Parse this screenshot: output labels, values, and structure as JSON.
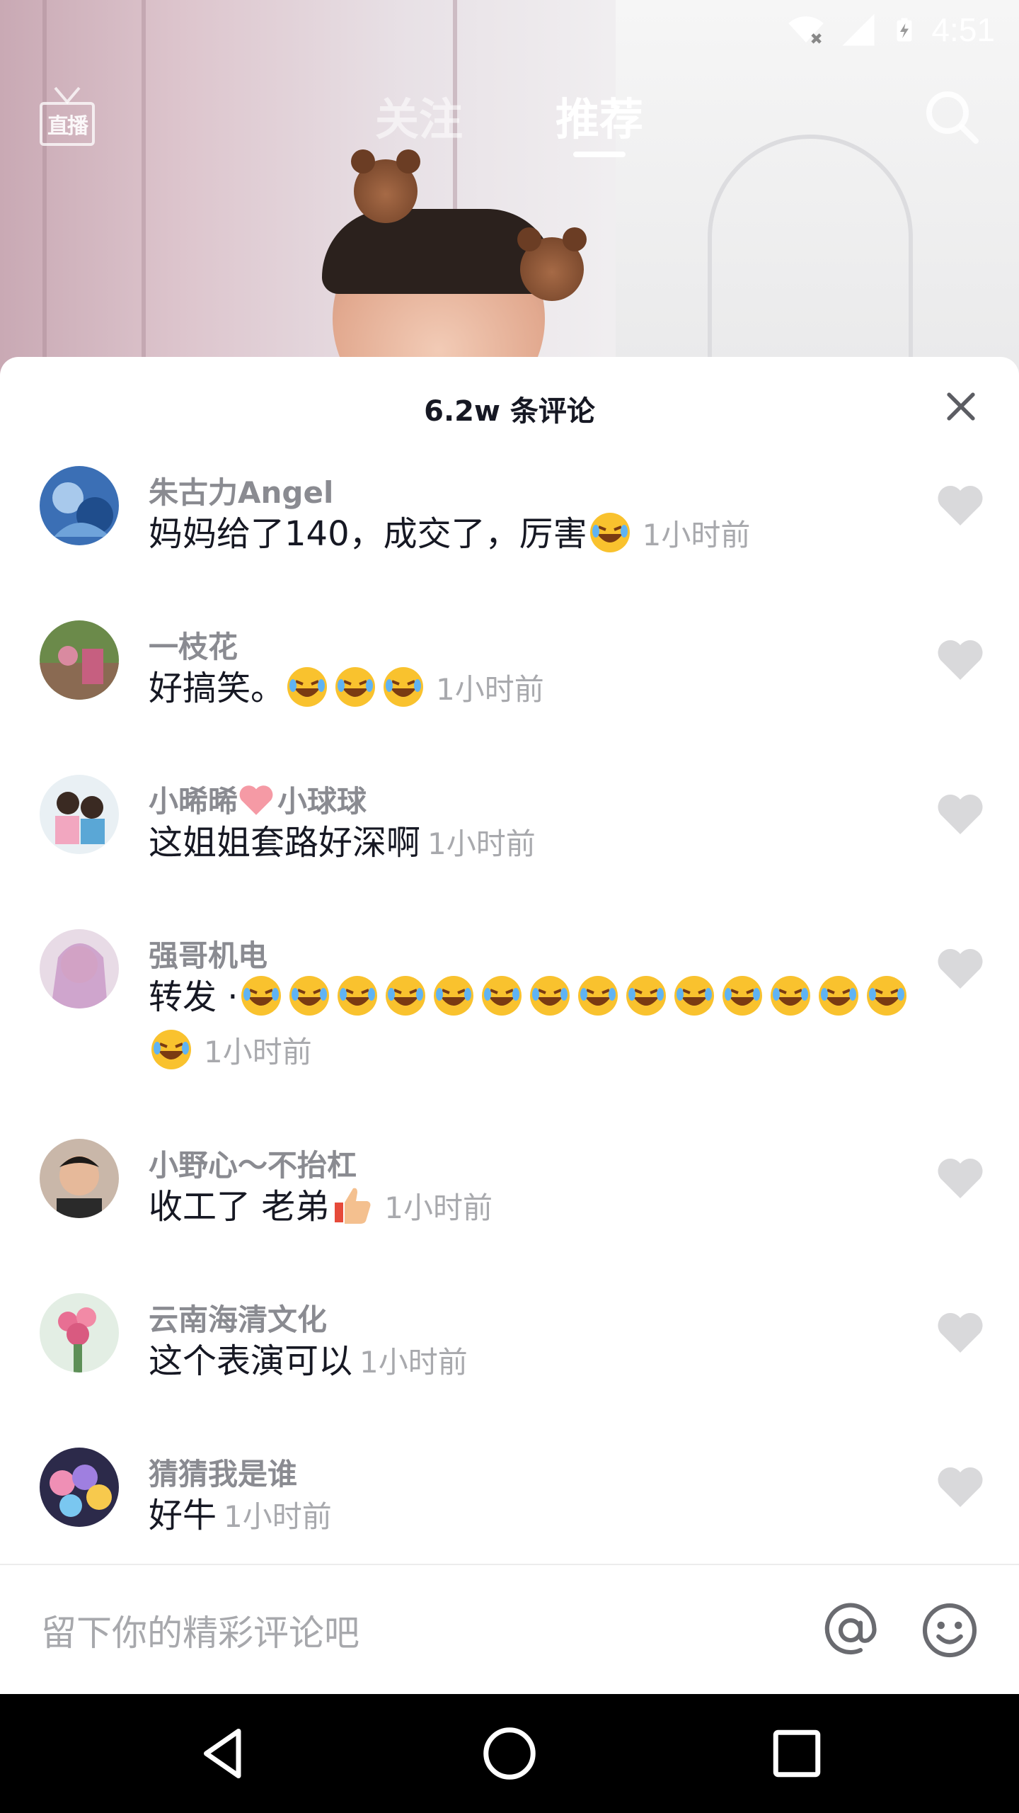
{
  "status_bar": {
    "time": "4:51"
  },
  "top_nav": {
    "live_label": "直播",
    "tabs": [
      {
        "label": "关注",
        "active": false
      },
      {
        "label": "推荐",
        "active": true
      }
    ]
  },
  "comments_panel": {
    "title": "6.2w 条评论",
    "comments": [
      {
        "user": "朱古力Angel",
        "text": "妈妈给了140，成交了，厉害",
        "emojis": [
          "rofl-emoji"
        ],
        "time": "1小时前"
      },
      {
        "user": "一枝花",
        "text": "好搞笑。",
        "emojis": [
          "rofl-emoji",
          "rofl-emoji",
          "rofl-emoji"
        ],
        "time": "1小时前"
      },
      {
        "user_before": "小晞晞",
        "user_after": "小球球",
        "user_emoji": "heart-emoji",
        "text": "这姐姐套路好深啊",
        "emojis": [],
        "time": "1小时前"
      },
      {
        "user": "强哥机电",
        "text": "转发 ·",
        "emojis": [
          "rofl-emoji",
          "rofl-emoji",
          "rofl-emoji",
          "rofl-emoji",
          "rofl-emoji",
          "rofl-emoji",
          "rofl-emoji",
          "rofl-emoji",
          "rofl-emoji",
          "rofl-emoji",
          "rofl-emoji",
          "rofl-emoji",
          "rofl-emoji",
          "rofl-emoji",
          "rofl-emoji"
        ],
        "time": "1小时前"
      },
      {
        "user": "小野心～不抬杠",
        "text": "收工了 老弟",
        "emojis": [
          "thumbs-up-emoji"
        ],
        "time": "1小时前"
      },
      {
        "user": "云南海清文化",
        "text": "这个表演可以",
        "emojis": [],
        "time": "1小时前"
      },
      {
        "user": "猜猜我是谁",
        "text": "好牛",
        "emojis": [],
        "time": "1小时前"
      }
    ],
    "input_placeholder": "留下你的精彩评论吧"
  },
  "colors": {
    "sheet_background": "#ffffff",
    "username": "#8a8b91",
    "comment_text": "#161823",
    "timestamp": "#a8a9ad",
    "like_heart": "#d9d9db"
  }
}
